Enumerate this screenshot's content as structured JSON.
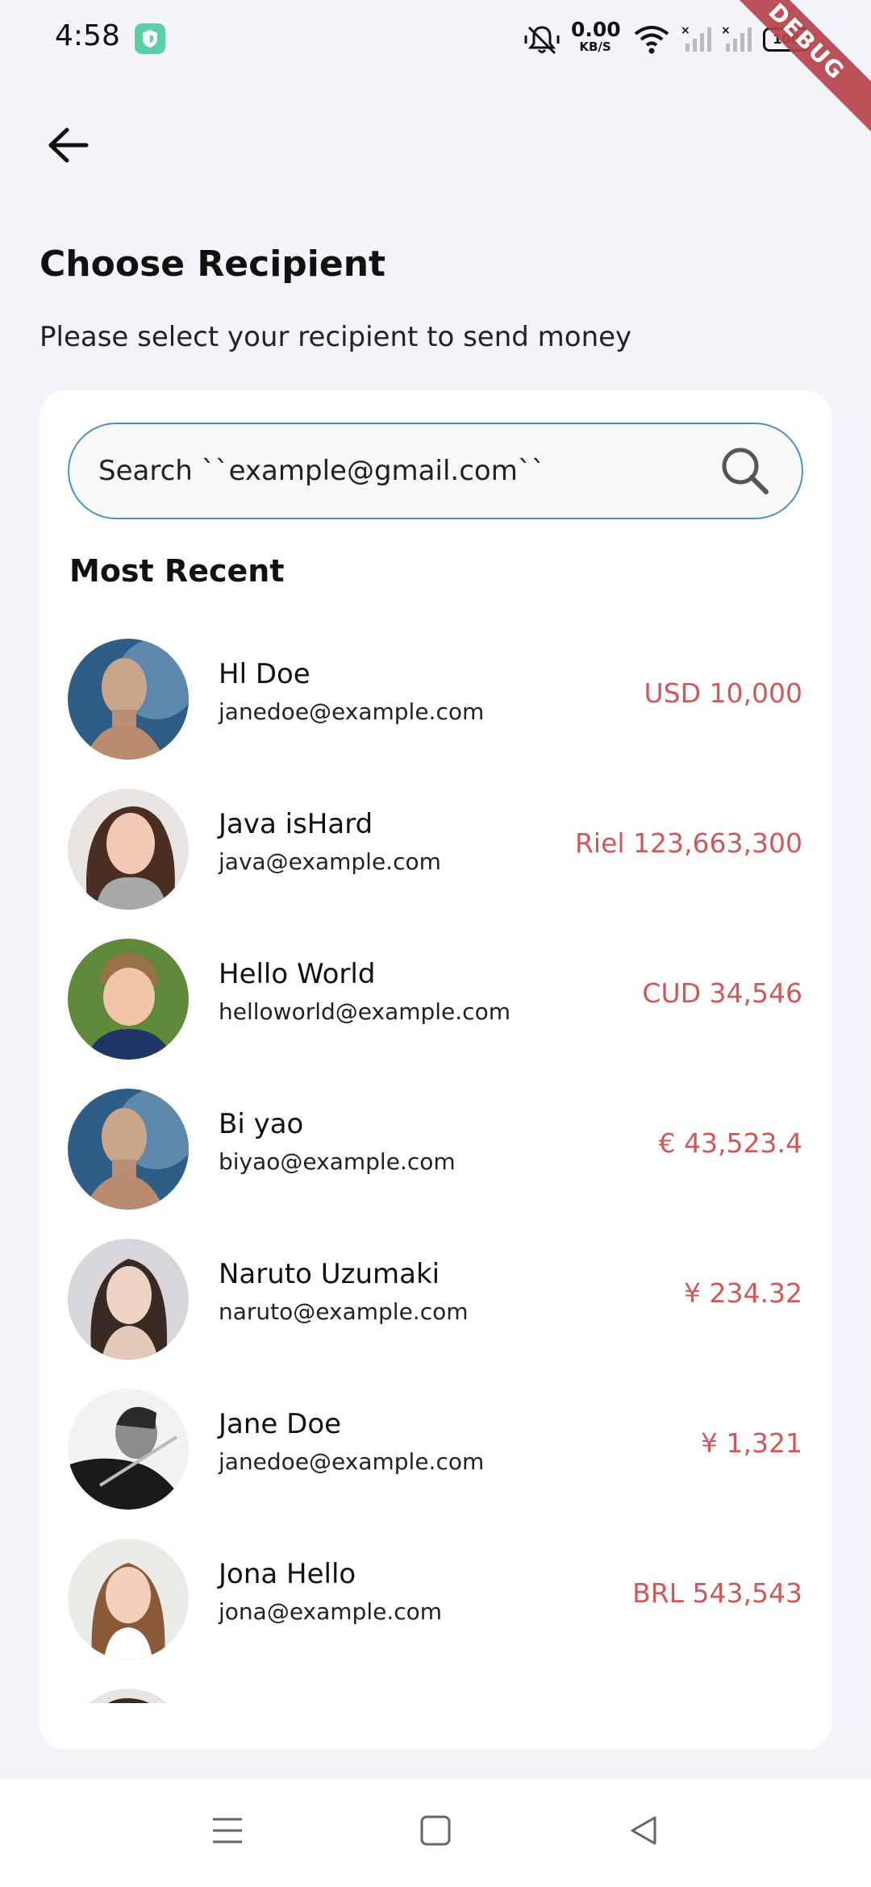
{
  "status_bar": {
    "time": "4:58",
    "speed_value": "0.00",
    "speed_unit": "KB/S",
    "battery": "100",
    "debug_banner": "DEBUG",
    "icons": [
      "shield-icon",
      "mute-icon",
      "wifi-icon",
      "signal-icon",
      "signal-icon",
      "battery-icon"
    ]
  },
  "header": {
    "back_icon": "arrow-left-icon",
    "title": "Choose Recipient",
    "subtitle": "Please select your recipient to send money"
  },
  "search": {
    "placeholder": "Search ``example@gmail.com``",
    "icon": "search-icon"
  },
  "section_title": "Most Recent",
  "recipients": [
    {
      "name": "Hl Doe",
      "email": "janedoe@example.com",
      "amount": "USD 10,000"
    },
    {
      "name": "Java isHard",
      "email": "java@example.com",
      "amount": "Riel 123,663,300"
    },
    {
      "name": "Hello World",
      "email": "helloworld@example.com",
      "amount": "CUD 34,546"
    },
    {
      "name": "Bi yao",
      "email": "biyao@example.com",
      "amount": "€ 43,523.4"
    },
    {
      "name": "Naruto Uzumaki",
      "email": "naruto@example.com",
      "amount": "¥ 234.32"
    },
    {
      "name": "Jane Doe",
      "email": "janedoe@example.com",
      "amount": "¥ 1,321"
    },
    {
      "name": "Jona Hello",
      "email": "jona@example.com",
      "amount": "BRL 543,543"
    }
  ],
  "colors": {
    "background": "#f5f4fa",
    "card": "#ffffff",
    "amount": "#d0585a",
    "search_border": "#4a90c9",
    "debug_ribbon": "#b5434b"
  },
  "nav_bar": {
    "icons": [
      "menu-icon",
      "home-square-icon",
      "back-triangle-icon"
    ]
  }
}
